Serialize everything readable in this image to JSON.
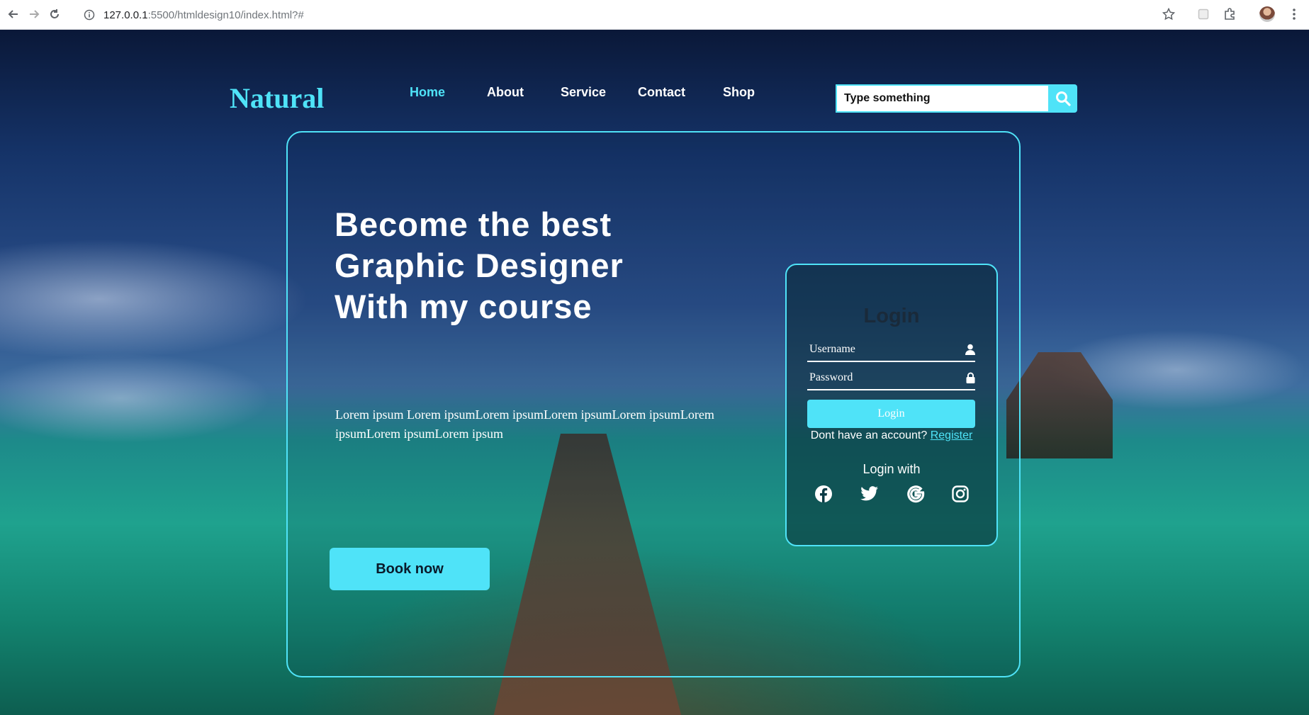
{
  "browser": {
    "url_host": "127.0.0.1",
    "url_path": ":5500/htmldesign10/index.html?#"
  },
  "header": {
    "logo": "Natural",
    "nav": [
      "Home",
      "About",
      "Service",
      "Contact",
      "Shop"
    ],
    "active_nav": "Home",
    "search_placeholder": "Type something"
  },
  "hero": {
    "headline_lines": [
      "Become the best",
      "Graphic Designer",
      "With my course"
    ],
    "lead": "Lorem ipsum Lorem ipsumLorem ipsumLorem ipsumLorem ipsumLorem ipsumLorem ipsumLorem ipsum",
    "cta": "Book now"
  },
  "login": {
    "title": "Login",
    "username_placeholder": "Username",
    "password_placeholder": "Password",
    "submit": "Login",
    "no_account": "Dont have an account?",
    "register": "Register",
    "login_with": "Login with",
    "socials": [
      "facebook-icon",
      "twitter-icon",
      "google-icon",
      "instagram-icon"
    ]
  },
  "colors": {
    "accent": "#4fe3f8",
    "text": "#ffffff"
  }
}
